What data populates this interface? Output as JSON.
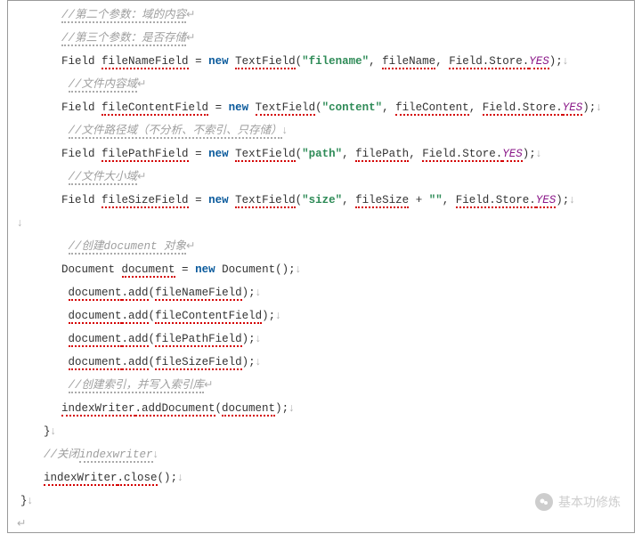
{
  "code": {
    "comment_param2": "//第二个参数：域的内容",
    "comment_param3": "//第三个参数：是否存储",
    "comment_filecontent": "//文件内容域",
    "comment_filepath": "//文件路径域（不分析、不索引、只存储）",
    "comment_filesize": "//文件大小域",
    "comment_create_doc": "//创建document 对象",
    "comment_create_index": "//创建索引，并写入索引库",
    "comment_close": "//关闭indexwriter",
    "sym_arrow": "↵",
    "sym_down": "↓",
    "kw_new": "new",
    "type_Field": "Field",
    "type_TextField": "TextField",
    "type_Document": "Document",
    "var_fileNameField": "fileNameField",
    "var_fileContentField": "fileContentField",
    "var_filePathField": "filePathField",
    "var_fileSizeField": "fileSizeField",
    "var_fileName": "fileName",
    "var_fileContent": "fileContent",
    "var_filePath": "filePath",
    "var_fileSize": "fileSize",
    "var_document": "document",
    "var_indexWriter": "indexWriter",
    "str_filename": "\"filename\"",
    "str_content": "\"content\"",
    "str_path": "\"path\"",
    "str_size": "\"size\"",
    "str_empty": "\"\"",
    "enum_yes": "YES",
    "enum_prefix": "Field.Store.",
    "method_add": ".add",
    "method_addDocument": ".addDocument",
    "method_close": ".close",
    "brace_close": "}",
    "paren_open": "(",
    "paren_close": ")",
    "semi": ";",
    "eq": " = ",
    "comma": ", ",
    "plus": " + ",
    "new_doc": "Document()"
  },
  "badge": {
    "text": "基本功修炼"
  }
}
